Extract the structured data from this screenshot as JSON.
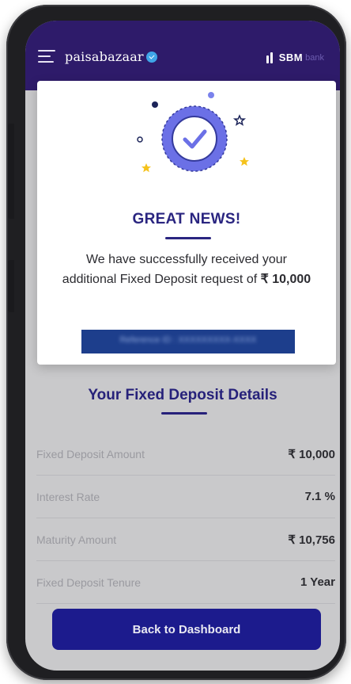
{
  "header": {
    "brand_name": "paisabazaar",
    "partner_brand": "SBM",
    "partner_sub": "bank",
    "brand_color": "#2e1b6a",
    "brand_badge_color": "#3fa5e8"
  },
  "modal": {
    "title": "GREAT NEWS!",
    "message": "We have successfully received your additional Fixed Deposit request of",
    "amount": "₹ 10,000",
    "success_icon": "check-circle-icon",
    "accent_color": "#6b70e6"
  },
  "details": {
    "title": "Your Fixed Deposit Details",
    "rows": [
      {
        "label": "Fixed Deposit Amount",
        "value": "₹ 10,000"
      },
      {
        "label": "Interest Rate",
        "value": "7.1 %"
      },
      {
        "label": "Maturity Amount",
        "value": "₹ 10,756"
      },
      {
        "label": "Fixed Deposit Tenure",
        "value": "1 Year"
      }
    ]
  },
  "actions": {
    "back_label": "Back to Dashboard",
    "button_color": "#1c1b8d"
  }
}
